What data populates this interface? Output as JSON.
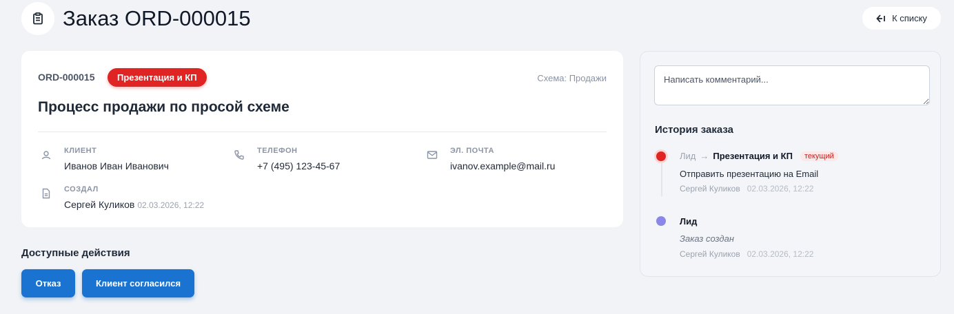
{
  "header": {
    "title": "Заказ ORD-000015",
    "back_label": "К списку",
    "icon": "clipboard-icon"
  },
  "order": {
    "id": "ORD-000015",
    "status": "Презентация и КП",
    "scheme": "Схема: Продажи",
    "title": "Процесс продажи по просой схеме",
    "fields": {
      "client": {
        "label": "КЛИЕНТ",
        "value": "Иванов Иван Иванович",
        "icon": "user-icon"
      },
      "phone": {
        "label": "ТЕЛЕФОН",
        "value": "+7 (495) 123-45-67",
        "icon": "phone-icon"
      },
      "email": {
        "label": "ЭЛ. ПОЧТА",
        "value": "ivanov.example@mail.ru",
        "icon": "mail-icon"
      },
      "creator": {
        "label": "СОЗДАЛ",
        "value": "Сергей Куликов",
        "timestamp": "02.03.2026, 12:22",
        "icon": "document-icon"
      }
    }
  },
  "actions": {
    "title": "Доступные действия",
    "buttons": [
      "Отказ",
      "Клиент согласился"
    ]
  },
  "sidebar": {
    "comment_placeholder": "Написать комментарий...",
    "history_title": "История заказа",
    "events": [
      {
        "from": "Лид",
        "arrow": "→",
        "to": "Презентация и КП",
        "tag": "текущий",
        "text": "Отправить презентацию на Email",
        "author": "Сергей Куликов",
        "date": "02.03.2026, 12:22",
        "color": "#e02424"
      },
      {
        "to": "Лид",
        "text": "Заказ создан",
        "author": "Сергей Куликов",
        "date": "02.03.2026, 12:22",
        "color": "#8b87e8"
      }
    ]
  },
  "colors": {
    "accent": "#1a73d1",
    "status": "#e02424",
    "background": "#f1f3f6"
  }
}
